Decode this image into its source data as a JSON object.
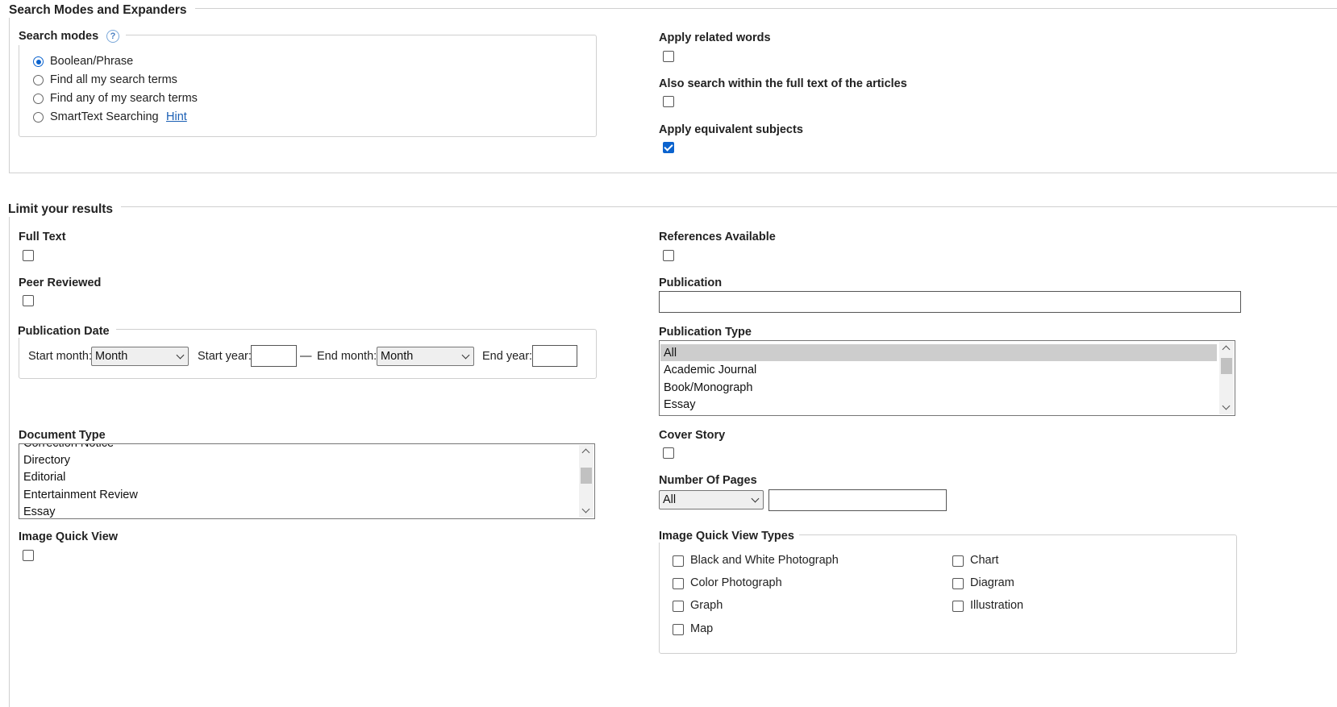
{
  "search_modes_section": {
    "title": "Search Modes and Expanders",
    "modes_label": "Search modes",
    "help_glyph": "?",
    "modes": [
      {
        "label": "Boolean/Phrase",
        "selected": true
      },
      {
        "label": "Find all my search terms",
        "selected": false
      },
      {
        "label": "Find any of my search terms",
        "selected": false
      },
      {
        "label": "SmartText Searching",
        "selected": false
      }
    ],
    "hint_link": "Hint",
    "expanders": [
      {
        "label": "Apply related words",
        "checked": false
      },
      {
        "label": "Also search within the full text of the articles",
        "checked": false
      },
      {
        "label": "Apply equivalent subjects",
        "checked": true
      }
    ]
  },
  "limits_section": {
    "title": "Limit your results",
    "full_text": {
      "label": "Full Text",
      "checked": false
    },
    "peer_reviewed": {
      "label": "Peer Reviewed",
      "checked": false
    },
    "publication_date": {
      "label": "Publication Date",
      "start_month_label": "Start month:",
      "start_month_value": "Month",
      "start_year_label": "Start year:",
      "start_year_value": "",
      "separator": "—",
      "end_month_label": "End month:",
      "end_month_value": "Month",
      "end_year_label": "End year:",
      "end_year_value": ""
    },
    "document_type": {
      "label": "Document Type",
      "options": [
        "Correction Notice",
        "Directory",
        "Editorial",
        "Entertainment Review",
        "Essay"
      ]
    },
    "image_quick_view": {
      "label": "Image Quick View",
      "checked": false
    },
    "references_available": {
      "label": "References Available",
      "checked": false
    },
    "publication": {
      "label": "Publication",
      "value": ""
    },
    "publication_type": {
      "label": "Publication Type",
      "options": [
        "All",
        "Academic Journal",
        "Book/Monograph",
        "Essay"
      ],
      "selected": "All"
    },
    "cover_story": {
      "label": "Cover Story",
      "checked": false
    },
    "number_of_pages": {
      "label": "Number Of Pages",
      "select_value": "All",
      "input_value": ""
    },
    "image_quick_view_types": {
      "label": "Image Quick View Types",
      "types": [
        {
          "label": "Black and White Photograph",
          "checked": false
        },
        {
          "label": "Chart",
          "checked": false
        },
        {
          "label": "Color Photograph",
          "checked": false
        },
        {
          "label": "Diagram",
          "checked": false
        },
        {
          "label": "Graph",
          "checked": false
        },
        {
          "label": "Illustration",
          "checked": false
        },
        {
          "label": "Map",
          "checked": false
        }
      ]
    }
  },
  "colors": {
    "accent": "#0b63ce",
    "link": "#1a5fb4",
    "border": "#d0d0d0"
  }
}
